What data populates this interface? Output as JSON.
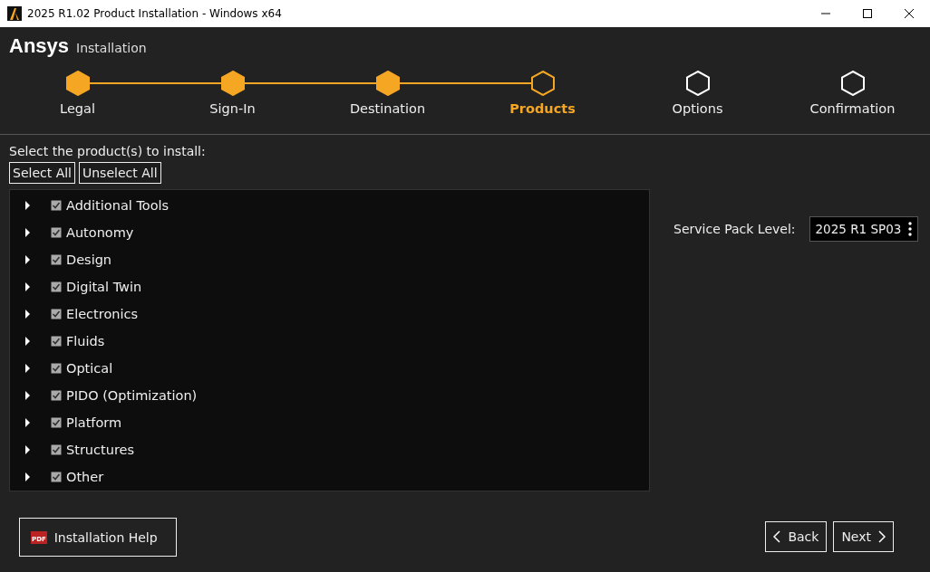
{
  "window": {
    "title": "2025 R1.02 Product Installation - Windows x64"
  },
  "header": {
    "logo": "Ansys",
    "subtitle": "Installation"
  },
  "steps": [
    {
      "label": "Legal",
      "completed": true,
      "selected": false
    },
    {
      "label": "Sign-In",
      "completed": true,
      "selected": false
    },
    {
      "label": "Destination",
      "completed": true,
      "selected": false
    },
    {
      "label": "Products",
      "completed": false,
      "selected": true
    },
    {
      "label": "Options",
      "completed": false,
      "selected": false
    },
    {
      "label": "Confirmation",
      "completed": false,
      "selected": false
    }
  ],
  "prompt": "Select the product(s) to install:",
  "select_buttons": [
    "Select All",
    "Unselect All"
  ],
  "products": [
    {
      "label": "Additional Tools",
      "checked": true,
      "expanded": false
    },
    {
      "label": "Autonomy",
      "checked": true,
      "expanded": false
    },
    {
      "label": "Design",
      "checked": true,
      "expanded": false
    },
    {
      "label": "Digital Twin",
      "checked": true,
      "expanded": false
    },
    {
      "label": "Electronics",
      "checked": true,
      "expanded": false
    },
    {
      "label": "Fluids",
      "checked": true,
      "expanded": false
    },
    {
      "label": "Optical",
      "checked": true,
      "expanded": false
    },
    {
      "label": "PIDO (Optimization)",
      "checked": true,
      "expanded": false
    },
    {
      "label": "Platform",
      "checked": true,
      "expanded": false
    },
    {
      "label": "Structures",
      "checked": true,
      "expanded": false
    },
    {
      "label": "Other",
      "checked": true,
      "expanded": false
    }
  ],
  "service_pack": {
    "label": "Service Pack Level:",
    "value": "2025 R1 SP03"
  },
  "help_button": {
    "icon_text": "PDF",
    "label": "Installation Help"
  },
  "nav_buttons": [
    "Back",
    "Next"
  ]
}
